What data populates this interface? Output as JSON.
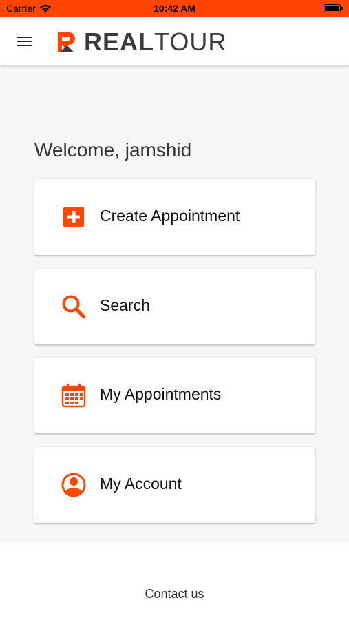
{
  "status_bar": {
    "carrier": "Carrier",
    "time": "10:42 AM"
  },
  "header": {
    "brand_part1": "REAL",
    "brand_part2": "TOUR"
  },
  "main": {
    "welcome": "Welcome, jamshid",
    "menu_items": [
      {
        "label": "Create Appointment",
        "icon": "add-box-icon"
      },
      {
        "label": "Search",
        "icon": "search-icon"
      },
      {
        "label": "My Appointments",
        "icon": "calendar-icon"
      },
      {
        "label": "My Account",
        "icon": "account-icon"
      }
    ]
  },
  "footer": {
    "contact_label": "Contact us"
  },
  "colors": {
    "accent": "#ff4500",
    "background": "#f6f6f6",
    "text": "#333333"
  }
}
